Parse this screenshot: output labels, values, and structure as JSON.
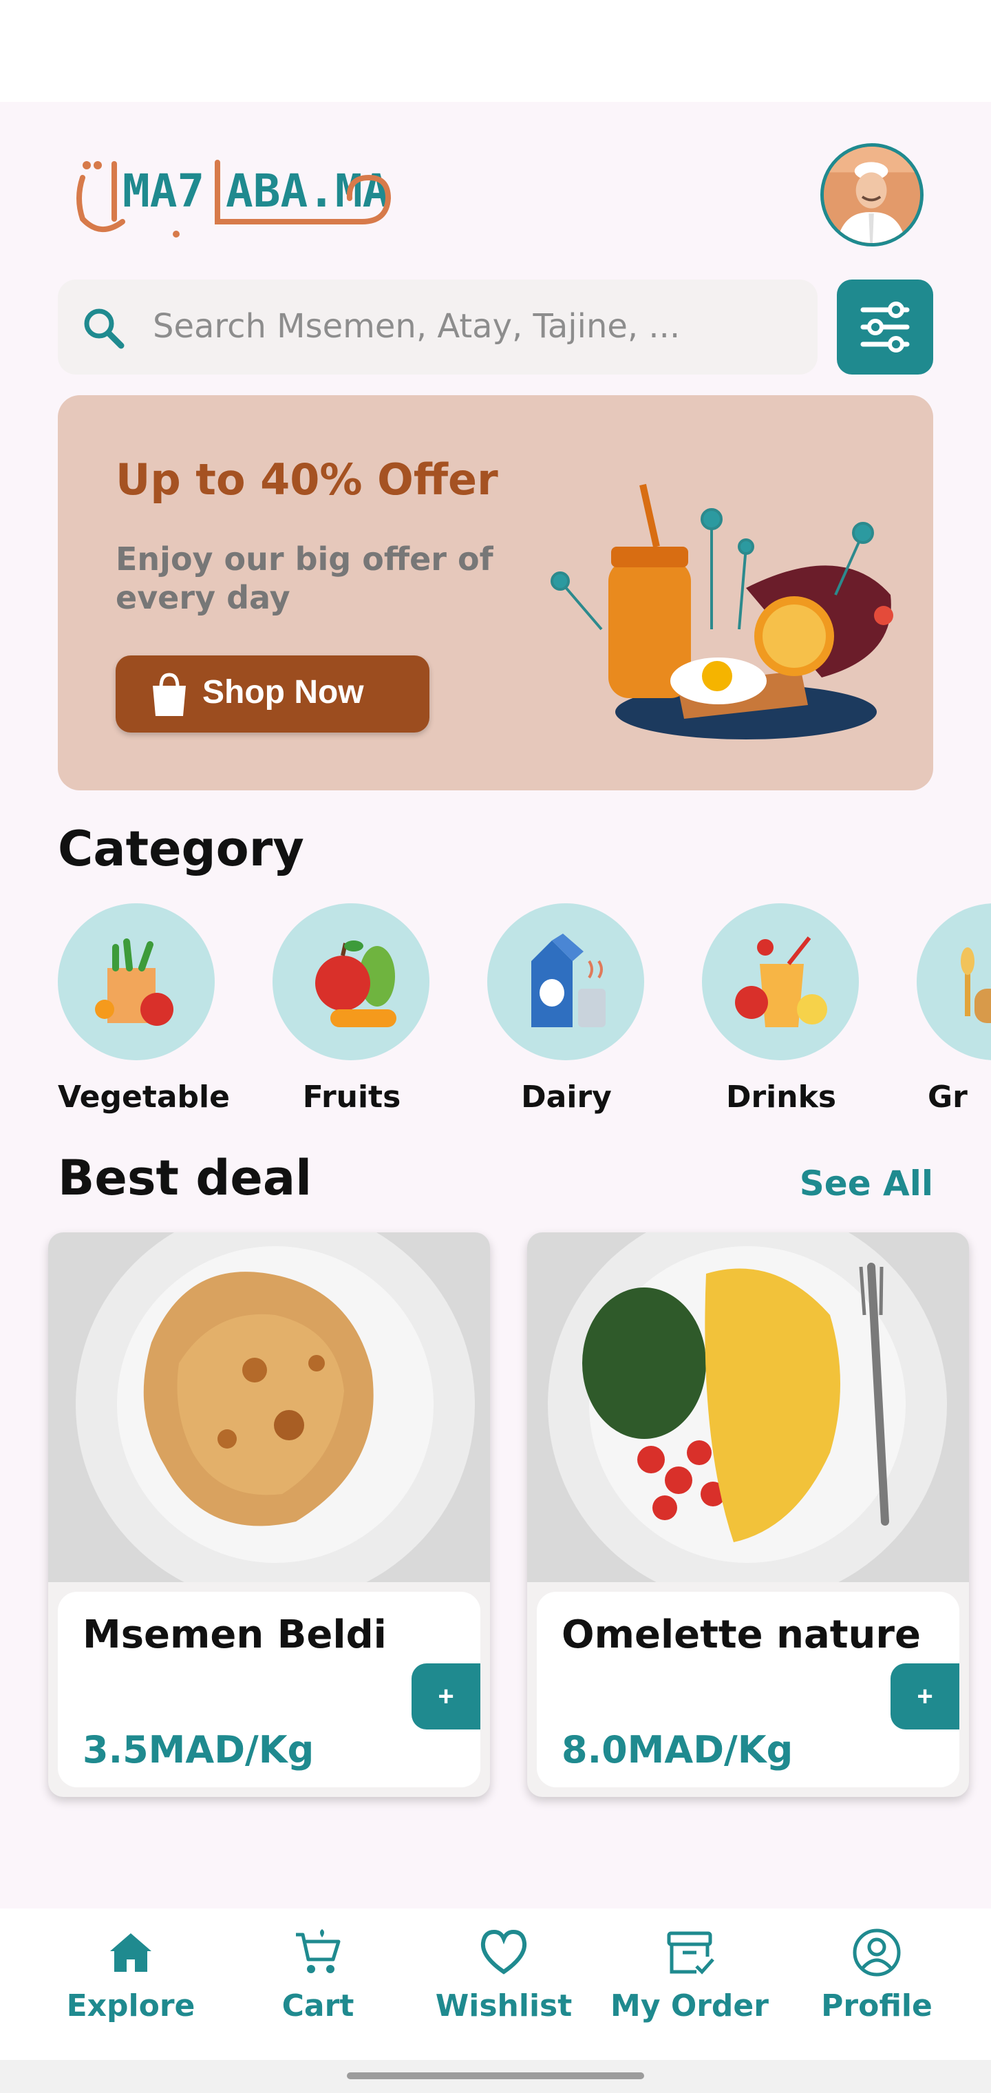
{
  "app": {
    "logo_text": "MA7LABA.MA",
    "avatar_alt": "chef avatar"
  },
  "search": {
    "placeholder": "Search Msemen, Atay, Tajine, ..."
  },
  "banner": {
    "title": "Up to 40% Offer",
    "subtitle": "Enjoy our big offer of every day",
    "button_label": "Shop Now"
  },
  "category": {
    "heading": "Category",
    "items": [
      {
        "label": "Vegetable",
        "icon": "vegetable-bag-icon"
      },
      {
        "label": "Fruits",
        "icon": "fruits-icon"
      },
      {
        "label": "Dairy",
        "icon": "milk-carton-icon"
      },
      {
        "label": "Drinks",
        "icon": "juice-glass-icon"
      },
      {
        "label": "Gr",
        "icon": "grain-icon"
      }
    ]
  },
  "best_deal": {
    "heading": "Best deal",
    "see_all": "See All",
    "products": [
      {
        "name": "Msemen Beldi",
        "price": "3.5MAD/Kg",
        "add": "+"
      },
      {
        "name": "Omelette nature",
        "price": "8.0MAD/Kg",
        "add": "+"
      }
    ]
  },
  "nav": {
    "items": [
      {
        "label": "Explore",
        "icon": "home-icon"
      },
      {
        "label": "Cart",
        "icon": "cart-icon"
      },
      {
        "label": "Wishlist",
        "icon": "heart-icon"
      },
      {
        "label": "My Order",
        "icon": "order-box-icon"
      },
      {
        "label": "Profile",
        "icon": "profile-icon"
      }
    ]
  },
  "colors": {
    "brand_teal": "#1f8a8f",
    "offer_brown": "#9c4d1f",
    "banner_bg": "#e6c8bb",
    "category_circle": "#bfe4e6"
  }
}
